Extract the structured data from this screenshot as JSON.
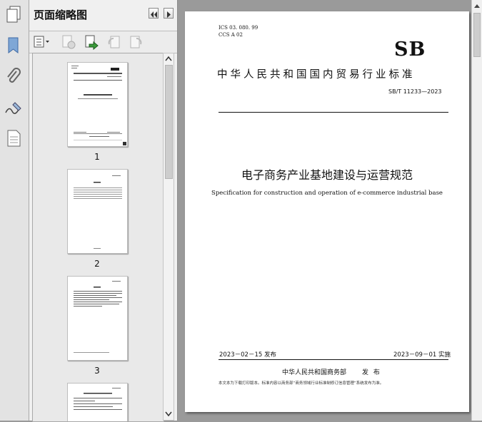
{
  "panel": {
    "title": "页面缩略图"
  },
  "thumbnails": [
    {
      "label": "1"
    },
    {
      "label": "2"
    },
    {
      "label": "3"
    }
  ],
  "document": {
    "ics": "ICS  03. 080. 99",
    "ccs": "CCS  A  02",
    "logo": "SB",
    "category": "中华人民共和国国内贸易行业标准",
    "standard_number": "SB/T 11233—2023",
    "title_cn": "电子商务产业基地建设与运营规范",
    "title_en": "Specification for construction and operation of e-commerce industrial base",
    "publish_date": "2023－02－15 发布",
    "effective_date": "2023－09－01 实施",
    "issuer": "中华人民共和国商务部",
    "issuer_action": "发 布",
    "footnote": "本文本为下载打印版本。标准内容以商务部“商务领域行业标准制修订信息管理”系统发布为准。"
  },
  "icons": [
    "copy-pages-icon",
    "bookmark-icon",
    "attachment-icon",
    "signature-icon",
    "page-icon",
    "options-menu-icon",
    "delete-page-icon",
    "insert-page-icon",
    "rotate-left-icon",
    "rotate-right-icon"
  ]
}
